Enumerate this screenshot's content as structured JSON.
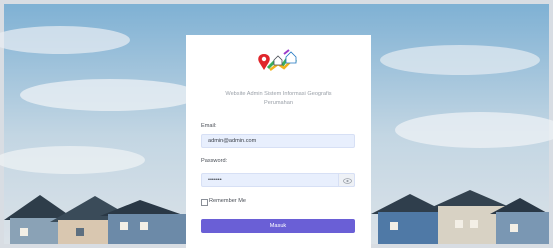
{
  "login": {
    "subtitle_line1": "Website Admin Sistem Informasi Geografis",
    "subtitle_line2": "Perumahan",
    "email_label": "Email:",
    "email_value": "admin@admin.com",
    "password_label": "Password:",
    "password_value": "•••••••",
    "remember_label": "Remember Me",
    "remember_checked": false,
    "submit_label": "Masuk",
    "password_toggle_icon": "eye-icon",
    "logo_icon": "map-pin-houses-logo"
  },
  "colors": {
    "accent": "#6a5fd6",
    "input_bg": "#e8effd"
  }
}
